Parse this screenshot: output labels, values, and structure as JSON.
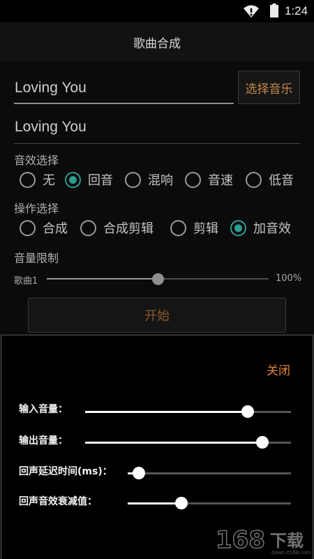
{
  "status_bar": {
    "time": "1:24",
    "wifi_icon": "wifi-icon",
    "battery_icon": "battery-icon"
  },
  "app": {
    "title": "歌曲合成"
  },
  "inputs": {
    "song1": {
      "value": "Loving You"
    },
    "song2": {
      "value": "Loving You"
    },
    "select_music_label": "选择音乐"
  },
  "effects": {
    "label": "音效选择",
    "options": [
      {
        "label": "无",
        "checked": false
      },
      {
        "label": "回音",
        "checked": true
      },
      {
        "label": "混响",
        "checked": false
      },
      {
        "label": "音速",
        "checked": false
      },
      {
        "label": "低音",
        "checked": false
      }
    ]
  },
  "operations": {
    "label": "操作选择",
    "options": [
      {
        "label": "合成",
        "checked": false
      },
      {
        "label": "合成剪辑",
        "checked": false
      },
      {
        "label": "剪辑",
        "checked": false
      },
      {
        "label": "加音效",
        "checked": true
      }
    ]
  },
  "volume_limit": {
    "label": "音量限制",
    "slider_label": "歌曲1",
    "value_text": "100%",
    "fraction": 0.5
  },
  "start_label": "开始",
  "dialog": {
    "close_label": "关闭",
    "sliders": [
      {
        "label": "输入音量：",
        "fraction": 0.79
      },
      {
        "label": "输出音量：",
        "fraction": 0.86
      },
      {
        "label": "回声延迟时间(ms)：",
        "fraction": 0.07
      },
      {
        "label": "回声音效衰减值：",
        "fraction": 0.33
      }
    ]
  },
  "colors": {
    "accent_teal": "#2f9c8e",
    "accent_orange": "#e3863a",
    "button_text_brown": "#c8894a"
  },
  "watermark": {
    "text": "168下载",
    "subtext": "down.it168.com"
  }
}
